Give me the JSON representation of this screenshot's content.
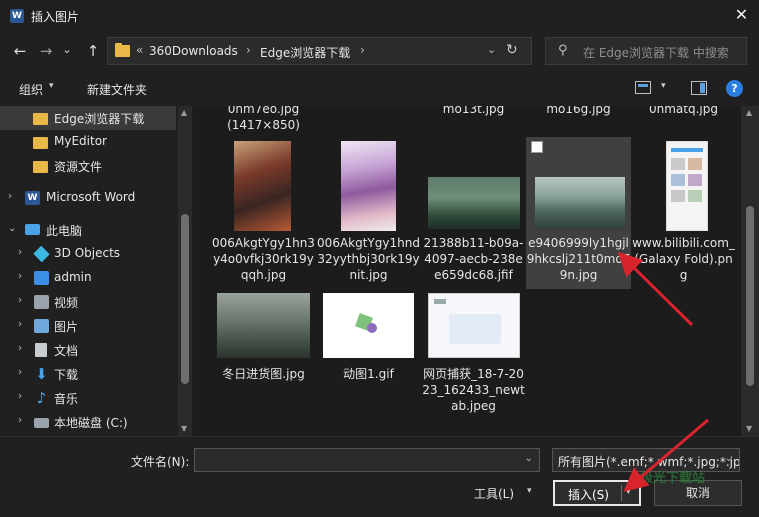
{
  "window": {
    "title": "插入图片",
    "app_icon_letter": "W",
    "close_glyph": "✕"
  },
  "nav": {
    "back_glyph": "←",
    "forward_glyph": "→",
    "recent_glyph": "⌄",
    "up_glyph": "↑",
    "breadcrumb_overflow": "«",
    "breadcrumbs": [
      "360Downloads",
      "Edge浏览器下载"
    ],
    "crumb_separator": "›",
    "refresh_glyph": "↻",
    "search_placeholder": "在 Edge浏览器下载 中搜索",
    "search_glyph": "⚲"
  },
  "toolbar": {
    "organize_label": "组织",
    "new_folder_label": "新建文件夹",
    "caret": "▾",
    "help_glyph": "?"
  },
  "sidebar": {
    "items": [
      {
        "label": "Edge浏览器下载",
        "icon": "folder-icon"
      },
      {
        "label": "MyEditor",
        "icon": "folder-icon"
      },
      {
        "label": "资源文件",
        "icon": "folder-icon"
      },
      {
        "label": "Microsoft Word",
        "icon": "word-icon",
        "expander": "›"
      },
      {
        "label": "此电脑",
        "icon": "computer-icon",
        "expander": "⌄"
      },
      {
        "label": "3D Objects",
        "icon": "3d-objects-icon",
        "expander": "›"
      },
      {
        "label": "admin",
        "icon": "user-folder-icon",
        "expander": "›"
      },
      {
        "label": "视频",
        "icon": "video-icon",
        "expander": "›"
      },
      {
        "label": "图片",
        "icon": "pictures-icon",
        "expander": "›"
      },
      {
        "label": "文档",
        "icon": "documents-icon",
        "expander": "›"
      },
      {
        "label": "下载",
        "icon": "download-icon",
        "expander": "›"
      },
      {
        "label": "音乐",
        "icon": "music-icon",
        "expander": "›"
      },
      {
        "label": "本地磁盘 (C:)",
        "icon": "disk-icon",
        "expander": "›"
      }
    ],
    "word_icon_letter": "W",
    "download_glyph": "⬇",
    "music_glyph": "♪",
    "scroll_up": "▲",
    "scroll_down": "▼"
  },
  "files": {
    "top_row_partial": [
      {
        "label": "0hm7eo.jpg\n(1417×850)"
      },
      {
        "label": "mo13t.jpg"
      },
      {
        "label": "mo16g.jpg"
      },
      {
        "label": "0hmatq.jpg"
      }
    ],
    "items": [
      {
        "label": "006AkgtYgy1hn3y4o0vfkj30rk19yqqh.jpg"
      },
      {
        "label": "006AkgtYgy1hnd32yythbj30rk19ynit.jpg"
      },
      {
        "label": "21388b11-b09a-4097-aecb-238ee659dc68.jfif"
      },
      {
        "label": "e9406999ly1hgjl9hkcslj211t0mo79n.jpg",
        "selected": true
      },
      {
        "label": "www.bilibili.com_(Galaxy Fold).png"
      },
      {
        "label": "冬日进货图.jpg"
      },
      {
        "label": "动图1.gif"
      },
      {
        "label": "网页捕获_18-7-2023_162433_newtab.jpeg"
      }
    ]
  },
  "bottom": {
    "filename_label": "文件名(N):",
    "filename_value": "",
    "filter_value": "所有图片(*.emf;*.wmf;*.jpg;*.jp",
    "caret": "⌄",
    "tools_label": "工具(L)",
    "insert_label": "插入(S)",
    "cancel_label": "取消",
    "watermark": "极光下载站"
  },
  "colors": {
    "background": "#202020",
    "accent": "#2a7de1",
    "folder": "#e8b849",
    "annotation_arrow": "#d9232d"
  }
}
